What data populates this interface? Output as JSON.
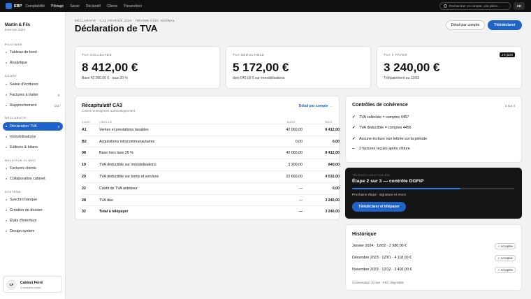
{
  "topbar": {
    "brand": "EBP",
    "nav": [
      "Comptabilité",
      "Pilotage",
      "Saisie",
      "Déclaratif",
      "Clients",
      "Paramètres"
    ],
    "active_nav": "Pilotage",
    "search_placeholder": "Rechercher un compte, une pièce…",
    "user_initials": "AK"
  },
  "org": {
    "name": "Martin & Fils",
    "exercice": "Exercice 2024"
  },
  "sidebar": {
    "sections": [
      {
        "label": "PILOTAGE",
        "items": [
          {
            "label": "Tableau de bord"
          },
          {
            "label": "Analytique"
          }
        ]
      },
      {
        "label": "SAISIE",
        "items": [
          {
            "label": "Saisie d'écritures"
          },
          {
            "label": "Factures à traiter",
            "count": "8"
          },
          {
            "label": "Rapprochement",
            "count": "142"
          }
        ]
      },
      {
        "label": "DÉCLARATIF",
        "items": [
          {
            "label": "Déclaration TVA",
            "count": "3",
            "active": true
          },
          {
            "label": "Immobilisations"
          },
          {
            "label": "Éditions & bilans"
          }
        ]
      },
      {
        "label": "RELATION CLIENT",
        "items": [
          {
            "label": "Factures clients"
          },
          {
            "label": "Collaboration cabinet"
          }
        ]
      },
      {
        "label": "SYSTÈME",
        "items": [
          {
            "label": "Synchro banque"
          },
          {
            "label": "Création de dossier"
          },
          {
            "label": "États d'interface"
          },
          {
            "label": "Design system"
          }
        ]
      }
    ],
    "cabinet": {
      "initials": "CF",
      "name": "Cabinet Ferré",
      "sub": "3 dossiers suivis"
    }
  },
  "header": {
    "breadcrumb": "DÉCLARATIF · CA3 FÉVRIER 2024 · RÉGIME RÉEL NORMAL",
    "title": "Déclaration de TVA",
    "detail_button": "Détail par compte",
    "primary_button": "Télédéclarer"
  },
  "kpis": [
    {
      "label": "TVA COLLECTÉE",
      "value": "8 412,00 €",
      "sub": "Base 42 060,00 € · taux 20 %"
    },
    {
      "label": "TVA DÉDUCTIBLE",
      "value": "5 172,00 €",
      "sub": "dont 640,00 € sur immobilisations"
    },
    {
      "label": "TVA À PAYER",
      "value": "3 240,00 €",
      "sub": "Télépaiement au 12/03",
      "badge": "J-5 jours"
    }
  ],
  "ca3": {
    "title": "Récapitulatif CA3",
    "subtitle": "Cases renseignées automatiquement",
    "link": "Détail par compte →",
    "headers": {
      "case": "CASE",
      "libelle": "LIBELLÉ",
      "base": "BASE",
      "taxe": "TAXE"
    },
    "rows": [
      {
        "case": "A1",
        "libelle": "Ventes et prestations taxables",
        "base": "42 060,00",
        "taxe": "8 412,00"
      },
      {
        "case": "B2",
        "libelle": "Acquisitions intracommunautaires",
        "base": "0,00",
        "taxe": "0,00"
      },
      {
        "case": "08",
        "libelle": "Base hors taxe 20 %",
        "base": "42 060,00",
        "taxe": "8 412,00"
      },
      {
        "case": "19",
        "libelle": "TVA déductible sur immobilisations",
        "base": "3 200,00",
        "taxe": "640,00"
      },
      {
        "case": "20",
        "libelle": "TVA déductible sur biens et services",
        "base": "22 660,00",
        "taxe": "4 532,00"
      },
      {
        "case": "22",
        "libelle": "Crédit de TVA antérieur",
        "base": "—",
        "taxe": "0,00"
      },
      {
        "case": "28",
        "libelle": "TVA due",
        "base": "—",
        "taxe": "3 240,00"
      },
      {
        "case": "32",
        "libelle": "Total à télépayer",
        "base": "—",
        "taxe": "3 240,00"
      }
    ]
  },
  "controls": {
    "title": "Contrôles de cohérence",
    "count": "4 sur 4",
    "items": [
      {
        "mark": "✓",
        "text": "TVA collectée = comptes 4457"
      },
      {
        "mark": "✓",
        "text": "TVA déductible = comptes 4456"
      },
      {
        "mark": "✓",
        "text": "Aucune écriture non lettrée sur la période"
      },
      {
        "mark": "–",
        "text": "2 factures reçues après clôture"
      }
    ]
  },
  "teledeclaration": {
    "label": "TÉLÉDÉCLARATION EDI",
    "title": "Étape 2 sur 3 — contrôle DGFiP",
    "progress": 0.67,
    "next": "Prochaine étape : signature et envoi",
    "button": "Télédéclarer et télépayer"
  },
  "history": {
    "title": "Historique",
    "rows": [
      {
        "text": "Janvier 2024 · 12/02 · 2 980,00 €",
        "status": "✓ Acceptée"
      },
      {
        "text": "Décembre 2023 · 12/01 · 4 118,00 €",
        "status": "✓ Acceptée"
      },
      {
        "text": "Novembre 2023 · 12/12 · 3 402,00 €",
        "status": "✓ Acceptée"
      }
    ],
    "footer": "Conservation 10 ans · FEC disponible"
  },
  "colors": {
    "accent": "#1d63c9",
    "dark": "#151515"
  }
}
